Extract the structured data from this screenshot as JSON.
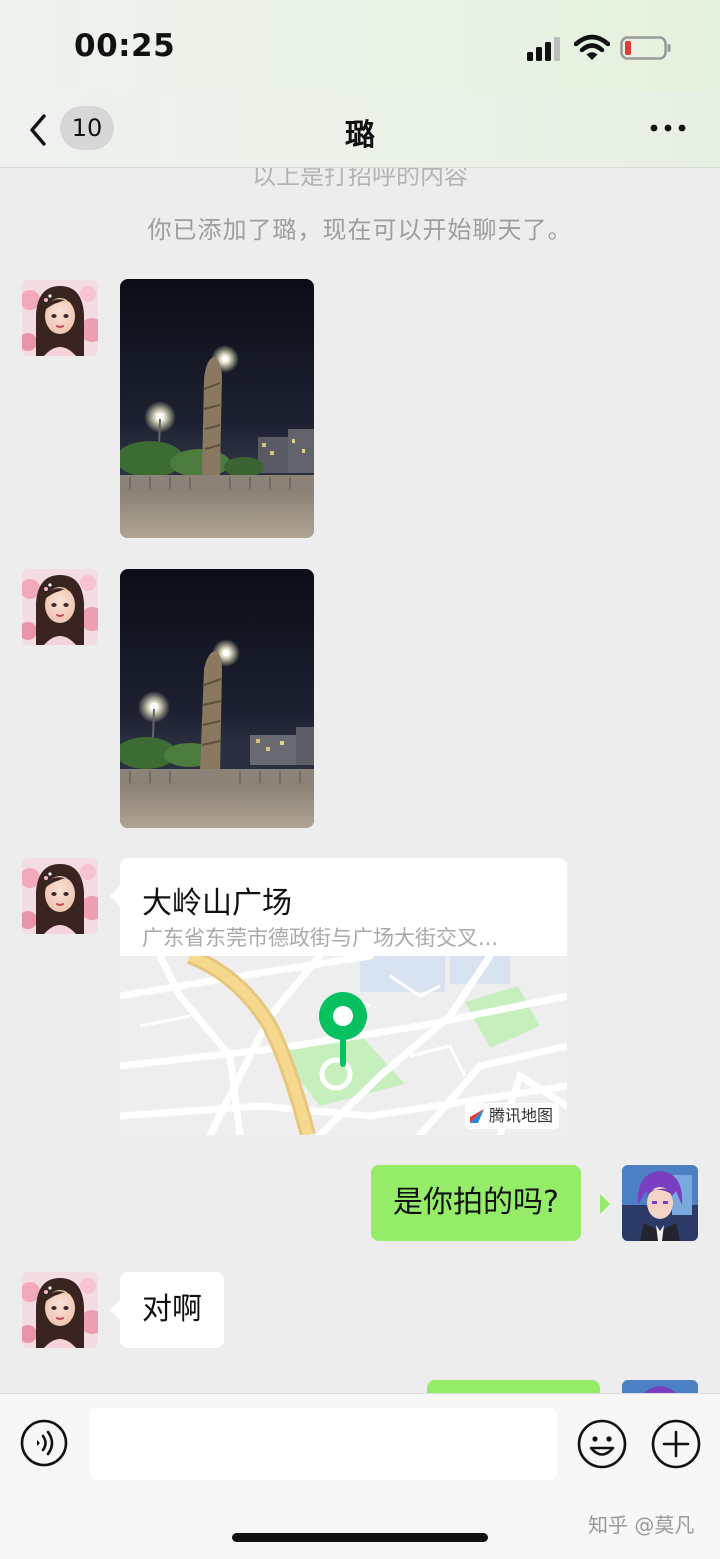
{
  "status_bar": {
    "time": "00:25",
    "signal_icon": "cellular-signal-icon",
    "wifi_icon": "wifi-icon",
    "battery_icon": "battery-low-icon",
    "battery_color": "#e53935"
  },
  "nav": {
    "back_icon": "chevron-left-icon",
    "unread_count": "10",
    "title": "璐",
    "more_icon": "more-dots-icon"
  },
  "chat": {
    "cut_off_text": "以上是打招呼的内容",
    "system_message": "你已添加了璐，现在可以开始聊天了。",
    "messages": [
      {
        "from": "璐",
        "type": "image",
        "description": "night photo of carved stone column",
        "avatar_icon": "girl-avatar"
      },
      {
        "from": "璐",
        "type": "image",
        "description": "night photo of carved stone column",
        "avatar_icon": "girl-avatar"
      },
      {
        "from": "璐",
        "type": "location",
        "title": "大岭山广场",
        "address": "广东省东莞市德政街与广场大街交叉...",
        "map_provider": "腾讯地图",
        "avatar_icon": "girl-avatar"
      },
      {
        "from": "me",
        "type": "text",
        "text": "是你拍的吗?",
        "avatar_icon": "anime-man-avatar"
      },
      {
        "from": "璐",
        "type": "text",
        "text": "对啊",
        "avatar_icon": "girl-avatar"
      },
      {
        "from": "me",
        "type": "text",
        "text": "",
        "avatar_icon": "anime-man-avatar"
      }
    ]
  },
  "input_bar": {
    "voice_icon": "voice-icon",
    "emoji_icon": "emoji-icon",
    "plus_icon": "plus-icon",
    "input_value": ""
  },
  "watermark": "知乎 @莫凡",
  "colors": {
    "sent_bubble": "#95ec69",
    "received_bubble": "#ffffff",
    "background": "#ededed",
    "map_pin": "#07c160"
  }
}
